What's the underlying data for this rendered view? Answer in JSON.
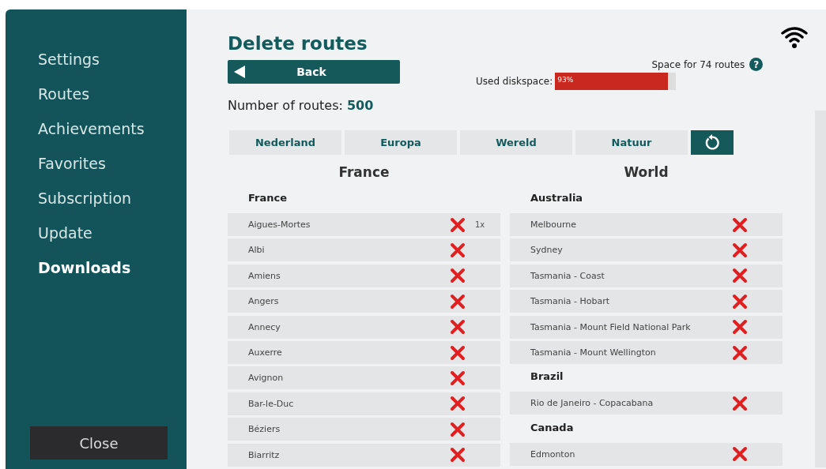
{
  "sidebar": {
    "items": [
      {
        "label": "Settings",
        "selected": false
      },
      {
        "label": "Routes",
        "selected": false
      },
      {
        "label": "Achievements",
        "selected": false
      },
      {
        "label": "Favorites",
        "selected": false
      },
      {
        "label": "Subscription",
        "selected": false
      },
      {
        "label": "Update",
        "selected": false
      },
      {
        "label": "Downloads",
        "selected": true
      }
    ],
    "close_button": "Close"
  },
  "title": "Delete routes",
  "back_button": "Back",
  "space": {
    "label": "Space for 74 routes",
    "help": "?",
    "disk_label": "Used diskspace:",
    "reading": "93%",
    "level": 0.93
  },
  "route_count": {
    "label": "Number of routes:",
    "value": "500"
  },
  "filters": [
    "Nederland",
    "Europa",
    "Wereld",
    "Natuur"
  ],
  "columns": [
    {
      "title": "France",
      "groups": [
        {
          "name": "France",
          "routes": [
            {
              "name": "Aigues-Mortes",
              "count": "1x"
            },
            {
              "name": "Albi"
            },
            {
              "name": "Amiens"
            },
            {
              "name": "Angers"
            },
            {
              "name": "Annecy"
            },
            {
              "name": "Auxerre"
            },
            {
              "name": "Avignon"
            },
            {
              "name": "Bar-le-Duc"
            },
            {
              "name": "Béziers"
            },
            {
              "name": "Biarritz"
            }
          ]
        }
      ]
    },
    {
      "title": "World",
      "groups": [
        {
          "name": "Australia",
          "routes": [
            {
              "name": "Melbourne"
            },
            {
              "name": "Sydney"
            },
            {
              "name": "Tasmania - Coast"
            },
            {
              "name": "Tasmania - Hobart"
            },
            {
              "name": "Tasmania - Mount Field National Park"
            },
            {
              "name": "Tasmania - Mount Wellington"
            }
          ]
        },
        {
          "name": "Brazil",
          "routes": [
            {
              "name": "Rio de Janeiro - Copacabana"
            }
          ]
        },
        {
          "name": "Canada",
          "routes": [
            {
              "name": "Edmonton"
            }
          ]
        }
      ]
    }
  ]
}
